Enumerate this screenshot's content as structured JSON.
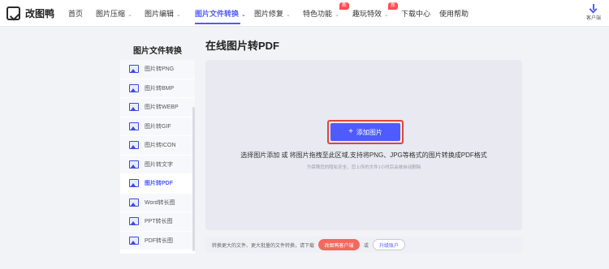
{
  "brand": {
    "name": "改图鸭"
  },
  "nav": {
    "items": [
      {
        "label": "首页",
        "has_dropdown": false,
        "active": false
      },
      {
        "label": "图片压缩",
        "has_dropdown": true,
        "active": false
      },
      {
        "label": "图片编辑",
        "has_dropdown": true,
        "active": false
      },
      {
        "label": "图片文件转换",
        "has_dropdown": true,
        "active": true
      },
      {
        "label": "图片修复",
        "has_dropdown": true,
        "active": false
      },
      {
        "label": "特色功能",
        "has_dropdown": true,
        "active": false,
        "badge": "新"
      },
      {
        "label": "趣玩特效",
        "has_dropdown": true,
        "active": false,
        "badge": "新"
      },
      {
        "label": "下载中心",
        "has_dropdown": false,
        "active": false
      },
      {
        "label": "使用帮助",
        "has_dropdown": false,
        "active": false
      }
    ],
    "dropdown_glyph": "⌄",
    "client_label": "客户端",
    "client_icon": "download-icon"
  },
  "sidebar": {
    "title": "图片文件转换",
    "items": [
      {
        "label": "图片转PNG",
        "active": false
      },
      {
        "label": "图片转BMP",
        "active": false
      },
      {
        "label": "图片转WEBP",
        "active": false
      },
      {
        "label": "图片转GIF",
        "active": false
      },
      {
        "label": "图片转ICON",
        "active": false
      },
      {
        "label": "图片转文字",
        "active": false
      },
      {
        "label": "图片转PDF",
        "active": true
      },
      {
        "label": "Word转长图",
        "active": false
      },
      {
        "label": "PPT转长图",
        "active": false
      },
      {
        "label": "PDF转长图",
        "active": false
      }
    ]
  },
  "main": {
    "title": "在线图片转PDF",
    "add_button": {
      "icon": "+",
      "label": "添加图片"
    },
    "drop_hint": "选择图片添加 或 将图片拖拽至此区域,支持将PNG、JPG等格式的图片转换成PDF格式",
    "privacy_note": "为保障您的隐私安全，您上传的文件1小时后会被自动删除"
  },
  "bottom": {
    "text": "转换更大的文件、更大批量的文件转换，请下载",
    "download_button": "改图鸭客户端",
    "or_text": "或",
    "upgrade_button": "升级账户"
  },
  "colors": {
    "accent": "#4f5bff",
    "badge": "#ff4d4f",
    "highlight_box": "#e0463b",
    "download_button": "#f26a5d"
  }
}
